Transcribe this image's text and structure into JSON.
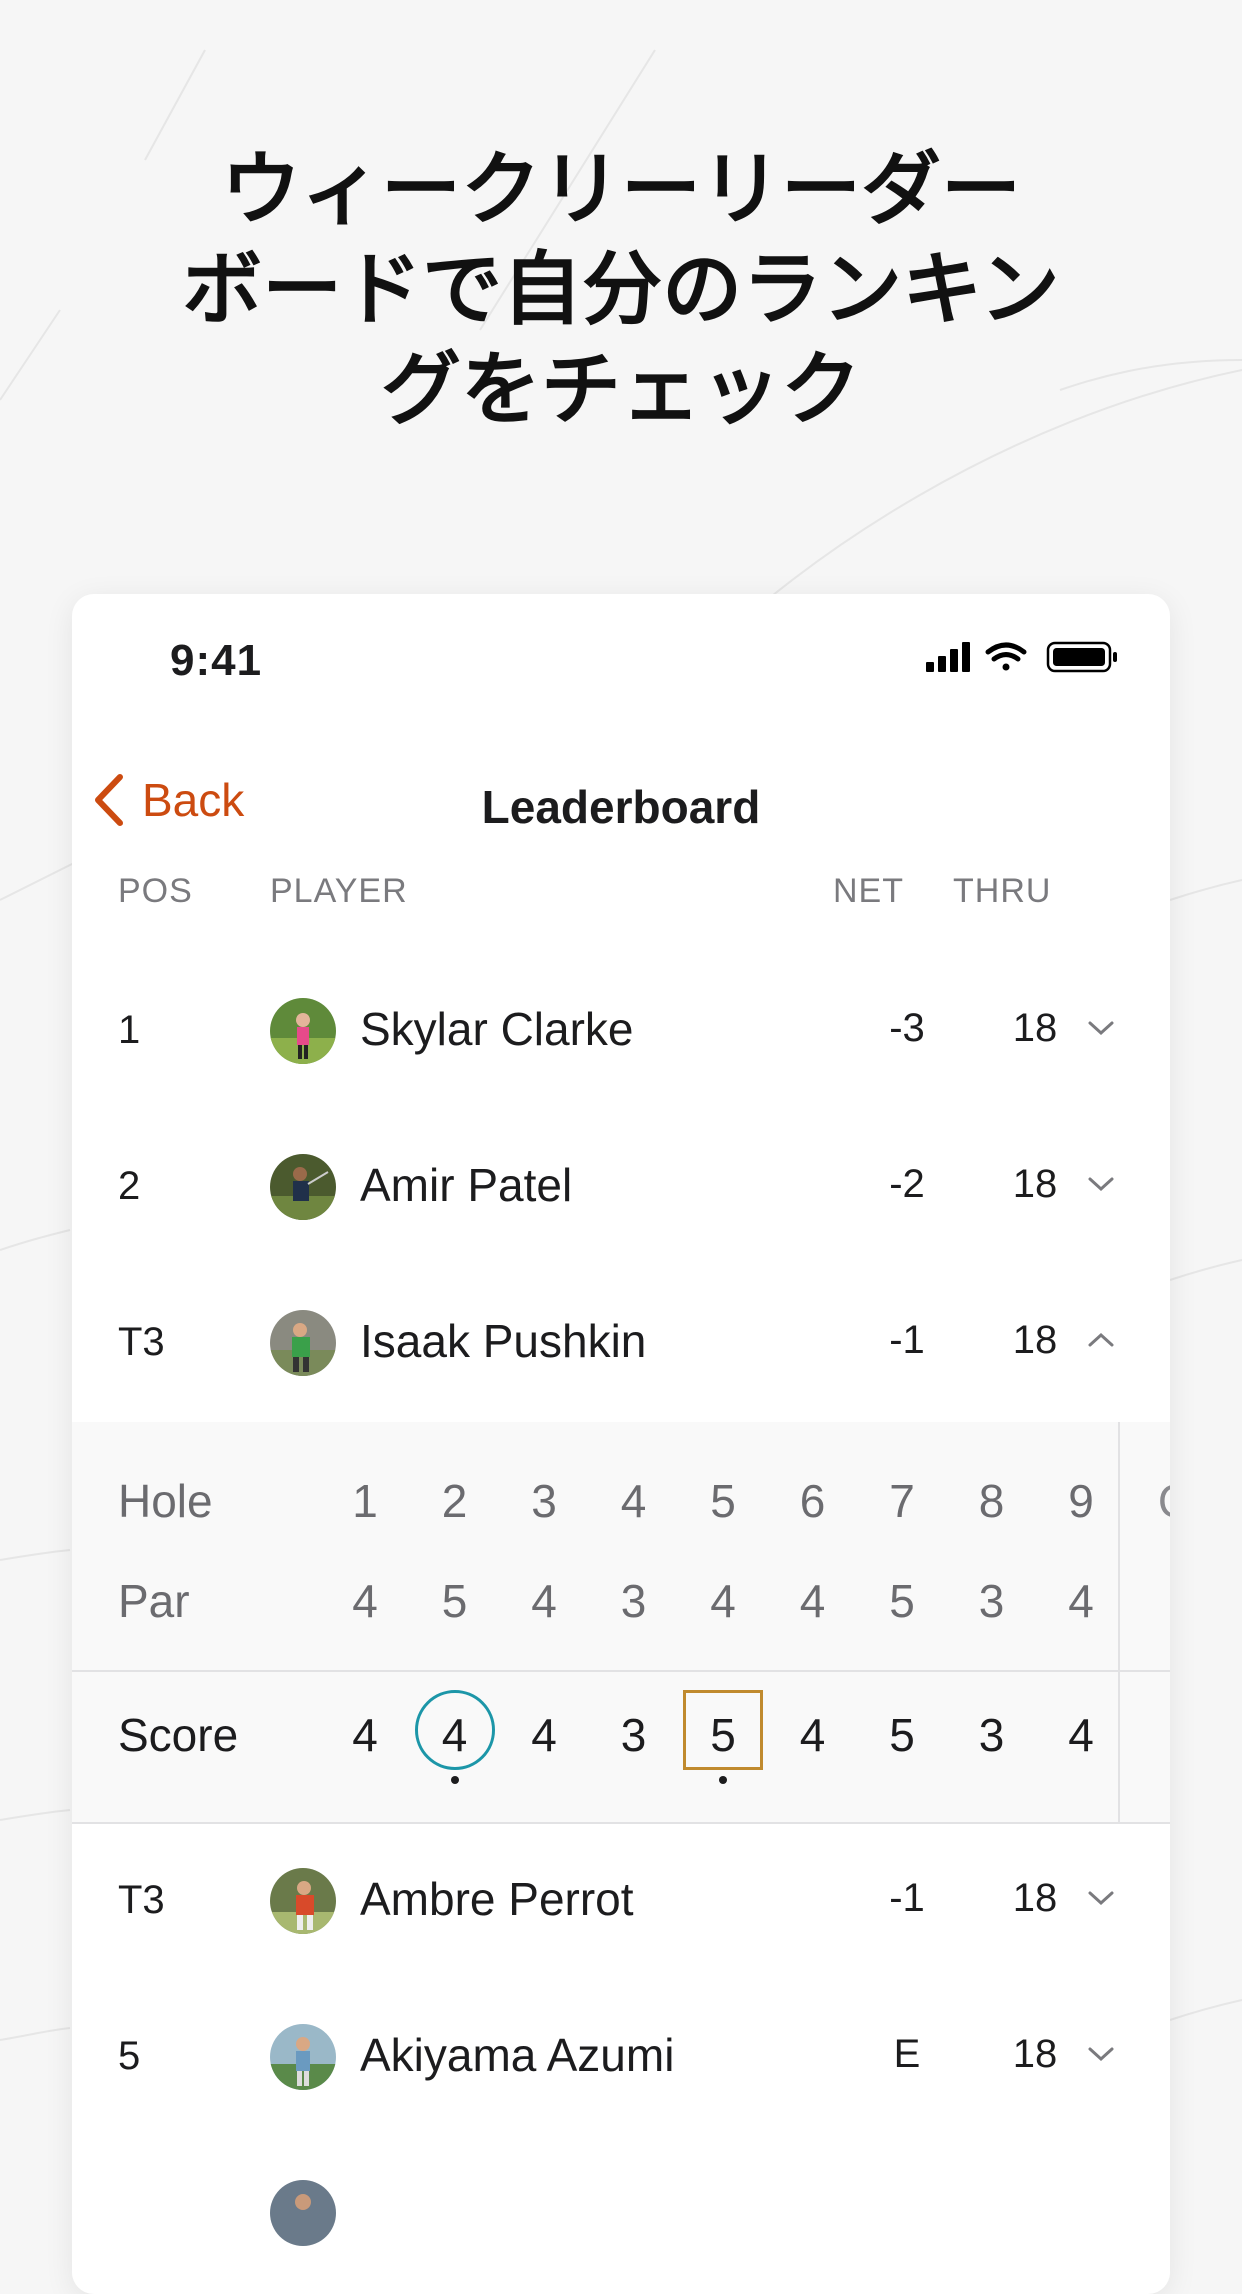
{
  "headline": {
    "lines": [
      "ウィークリーリーダー",
      "ボードで自分のランキン",
      "グをチェック"
    ]
  },
  "status_bar": {
    "time": "9:41"
  },
  "nav": {
    "back_label": "Back",
    "title": "Leaderboard"
  },
  "columns": {
    "pos": "POS",
    "player": "PLAYER",
    "net": "NET",
    "thru": "THRU"
  },
  "rows": [
    {
      "pos": "1",
      "name": "Skylar Clarke",
      "net": "-3",
      "thru": "18",
      "expanded": false
    },
    {
      "pos": "2",
      "name": "Amir Patel",
      "net": "-2",
      "thru": "18",
      "expanded": false
    },
    {
      "pos": "T3",
      "name": "Isaak Pushkin",
      "net": "-1",
      "thru": "18",
      "expanded": true
    },
    {
      "pos": "T3",
      "name": "Ambre Perrot",
      "net": "-1",
      "thru": "18",
      "expanded": false
    },
    {
      "pos": "5",
      "name": "Akiyama Azumi",
      "net": "E",
      "thru": "18",
      "expanded": false
    }
  ],
  "scorecard": {
    "hole_label": "Hole",
    "par_label": "Par",
    "score_label": "Score",
    "holes": [
      "1",
      "2",
      "3",
      "4",
      "5",
      "6",
      "7",
      "8",
      "9"
    ],
    "par": [
      "4",
      "5",
      "4",
      "3",
      "4",
      "4",
      "5",
      "3",
      "4"
    ],
    "score": [
      "4",
      "4",
      "4",
      "3",
      "5",
      "4",
      "5",
      "3",
      "4"
    ],
    "circled_hole": "2",
    "boxed_hole": "5"
  },
  "colors": {
    "accent": "#cc4b10",
    "birdie_circle": "#1c96a8",
    "bogey_box": "#c08a2e"
  }
}
